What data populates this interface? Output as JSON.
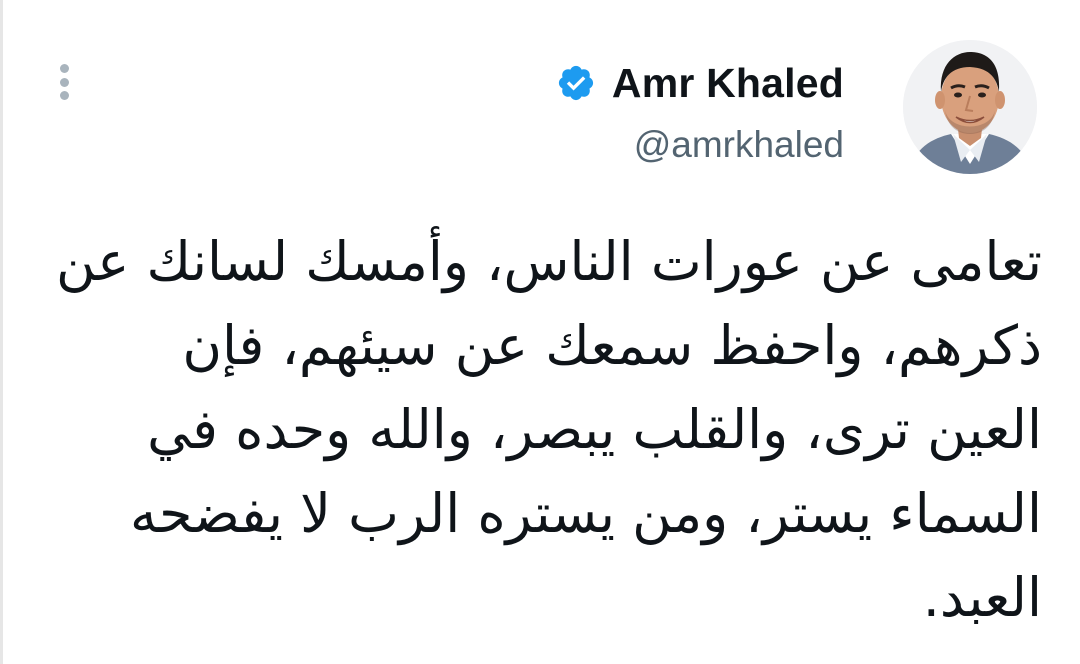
{
  "author": {
    "display_name": "Amr Khaled",
    "handle": "@amrkhaled",
    "verified": true,
    "avatar_icon": "profile-photo"
  },
  "tweet": {
    "lines": [
      "تعامى عن عورات الناس، وأمسك لسانك عن",
      "ذكرهم، واحفظ سمعك عن سيئهم، فإن",
      "العين ترى، والقلب يبصر، والله وحده في",
      "السماء يستر، ومن يستره الرب لا يفضحه",
      "العبد."
    ]
  },
  "icons": {
    "more": "more-vertical-icon",
    "verified": "verified-badge-icon"
  },
  "colors": {
    "text_primary": "#0f1419",
    "text_secondary": "#536471",
    "verified_blue": "#1d9bf0",
    "more_dots": "#a9b4bd"
  }
}
